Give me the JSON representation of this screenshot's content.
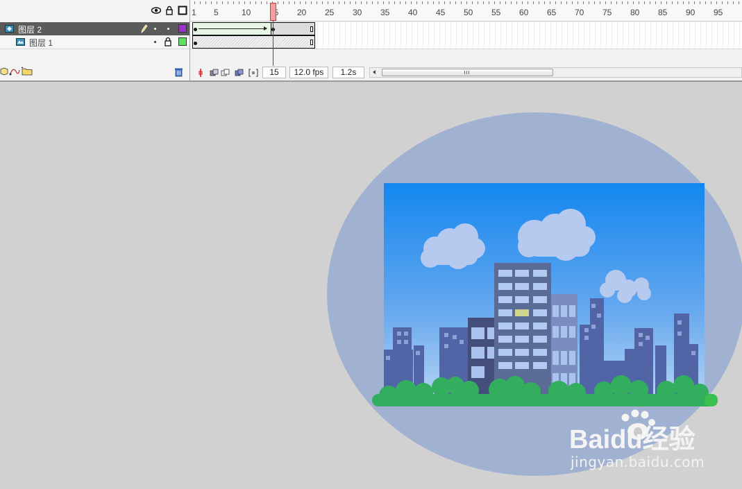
{
  "timeline": {
    "layers": [
      {
        "name": "图层 2",
        "selected": true,
        "color": "#9b36c9"
      },
      {
        "name": "图层 1",
        "selected": false,
        "color": "#5fe05f"
      }
    ],
    "ruler_numbers": [
      "1",
      "5",
      "10",
      "15",
      "20",
      "25",
      "30",
      "35",
      "40",
      "45",
      "50",
      "55",
      "60",
      "65",
      "70",
      "75",
      "80",
      "85",
      "90",
      "95"
    ],
    "current_frame": "15",
    "frame_rate": "12.0 fps",
    "elapsed_time": "1.2s"
  },
  "stage": {
    "background_color": "#d1d1d1",
    "ellipse_color": "#a0b1d1"
  },
  "watermark": {
    "logo": "Baidu经验",
    "domain": "jingyan.baidu.com"
  }
}
